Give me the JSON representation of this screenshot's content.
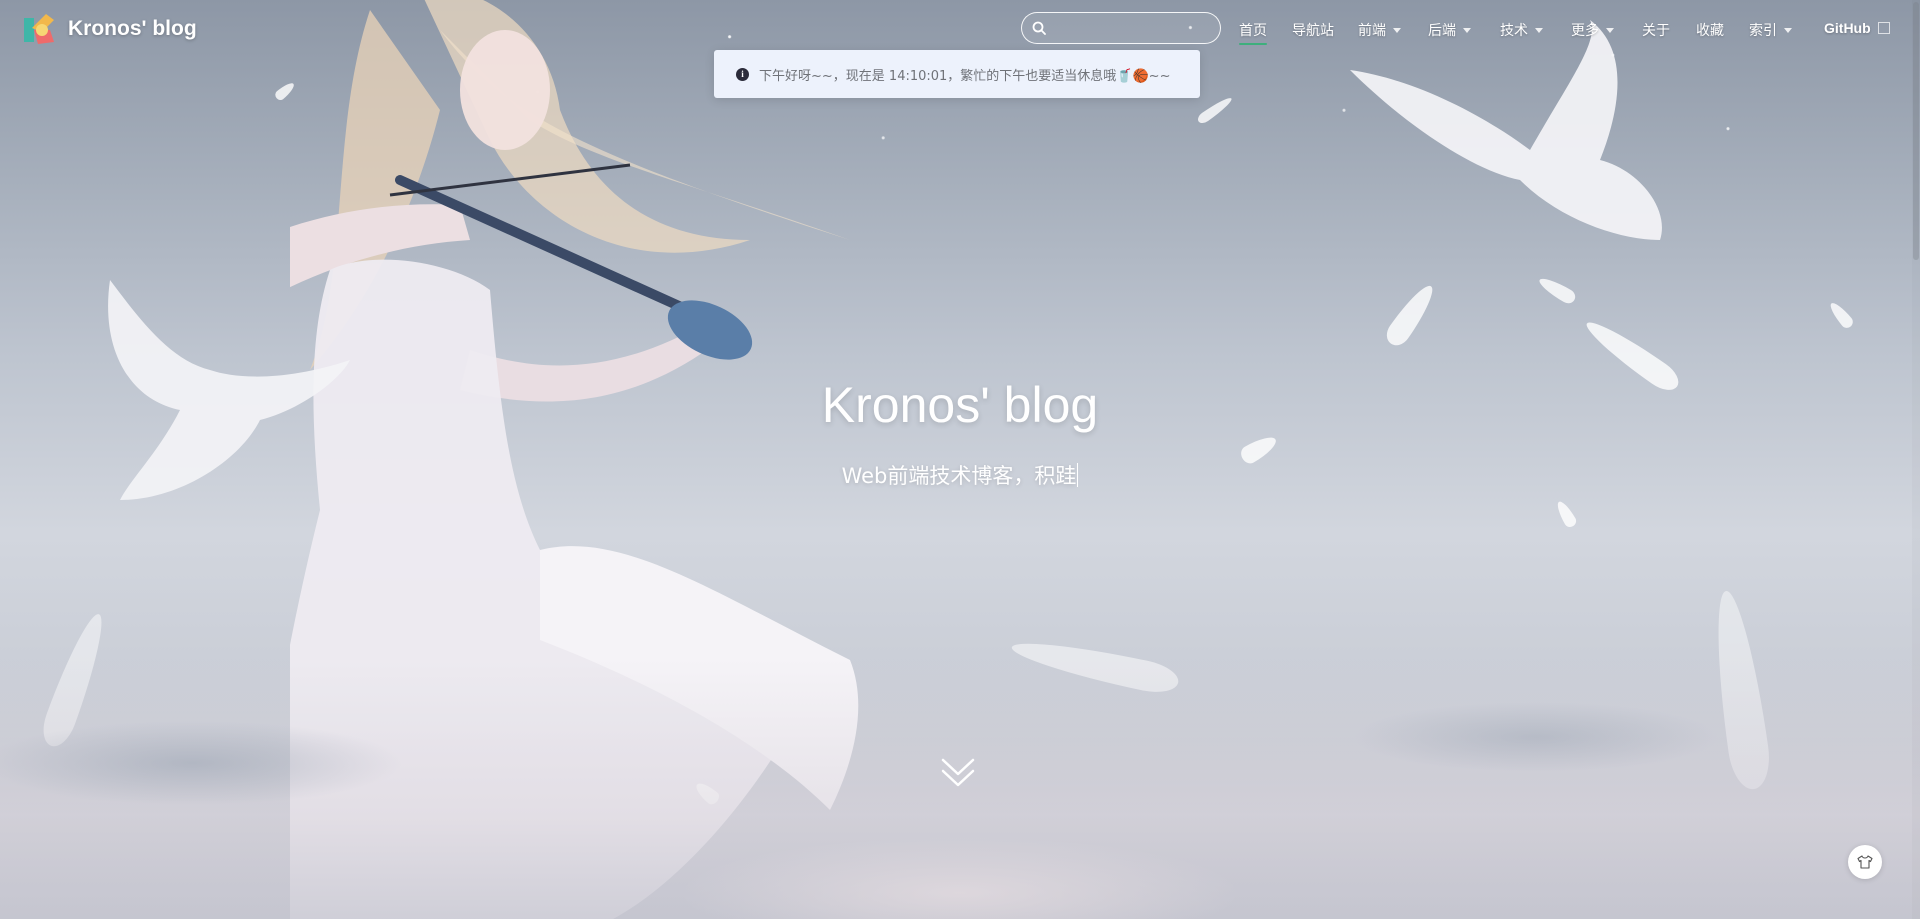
{
  "brand": {
    "title": "Kronos' blog",
    "logo_icon": "kronos-logo-icon"
  },
  "search": {
    "placeholder": "",
    "value": ""
  },
  "nav": {
    "items": [
      {
        "label": "首页",
        "active": true,
        "dropdown": false
      },
      {
        "label": "导航站",
        "active": false,
        "dropdown": false
      },
      {
        "label": "前端",
        "active": false,
        "dropdown": true
      },
      {
        "label": "后端",
        "active": false,
        "dropdown": true
      },
      {
        "label": "技术",
        "active": false,
        "dropdown": true
      },
      {
        "label": "更多",
        "active": false,
        "dropdown": true
      },
      {
        "label": "关于",
        "active": false,
        "dropdown": false
      },
      {
        "label": "收藏",
        "active": false,
        "dropdown": false
      },
      {
        "label": "索引",
        "active": false,
        "dropdown": true
      },
      {
        "label": "GitHub",
        "active": false,
        "external": true
      }
    ]
  },
  "notice": {
    "text": "下午好呀~~，现在是 14:10:01，繁忙的下午也要适当休息哦🥤🏀~~"
  },
  "hero": {
    "title": "Kronos' blog",
    "subtitle": "Web前端技术博客，积跬"
  },
  "colors": {
    "accent": "#3eaf7c",
    "notice_bg": "#edf2fc",
    "text_white": "#ffffff"
  }
}
